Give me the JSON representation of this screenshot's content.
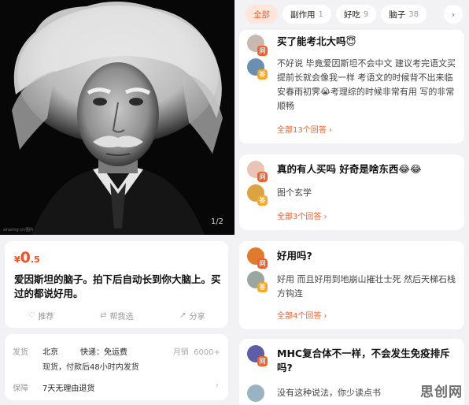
{
  "left": {
    "image_counter": "1/2",
    "image_credit": "sinaimg.cn/图片",
    "price": {
      "currency": "¥",
      "integer": "0",
      "decimal": ".5"
    },
    "description": "爱因斯坦的脑子。拍下后自动长到你大脑上。买过的都说好用。",
    "actions": [
      {
        "label": "推荐",
        "icon": "thumb-up-icon"
      },
      {
        "label": "帮我选",
        "icon": "help-choose-icon"
      },
      {
        "label": "分享",
        "icon": "share-icon"
      }
    ],
    "shipping": {
      "label": "发货",
      "location": "北京",
      "delivery": "快递：免运费",
      "sales_label": "月销",
      "sales_value": "6000+",
      "detail": "现货，付款后48小时内发货"
    },
    "guarantee": {
      "label": "保障",
      "value": "7天无理由退货"
    }
  },
  "right": {
    "tabs": [
      {
        "label": "全部",
        "count": "",
        "active": true
      },
      {
        "label": "副作用",
        "count": "1",
        "active": false
      },
      {
        "label": "好吃",
        "count": "9",
        "active": false
      },
      {
        "label": "脑子",
        "count": "38",
        "active": false
      }
    ],
    "qa": [
      {
        "question": "买了能考北大吗😇",
        "answer": "不好说 毕竟爱因斯坦不会中文 建议考完语文买 提前长就会像我一样 考语文的时候背不出来临安春雨初霁😭考理综的时候非常有用 写的非常顺畅",
        "more": "全部13个回答 ›"
      },
      {
        "question": "真的有人买吗 好奇是啥东西😂😂",
        "answer": "图个玄学",
        "more": "全部3个回答 ›"
      },
      {
        "question": "好用吗?",
        "answer": "好用 而且好用到地崩山摧壮士死 然后天梯石栈方钩连",
        "more": "全部4个回答 ›"
      },
      {
        "question": "MHC复合体不一样，不会发生免疫排斥吗?",
        "answer": "没有这种说法，你少读点书",
        "more": ""
      }
    ],
    "badge_q": "问",
    "badge_a": "答"
  },
  "watermark": "思创网",
  "colors": {
    "accent": "#ff5a1f",
    "answer_badge": "#ffa51f",
    "background": "#f2f2f4"
  }
}
